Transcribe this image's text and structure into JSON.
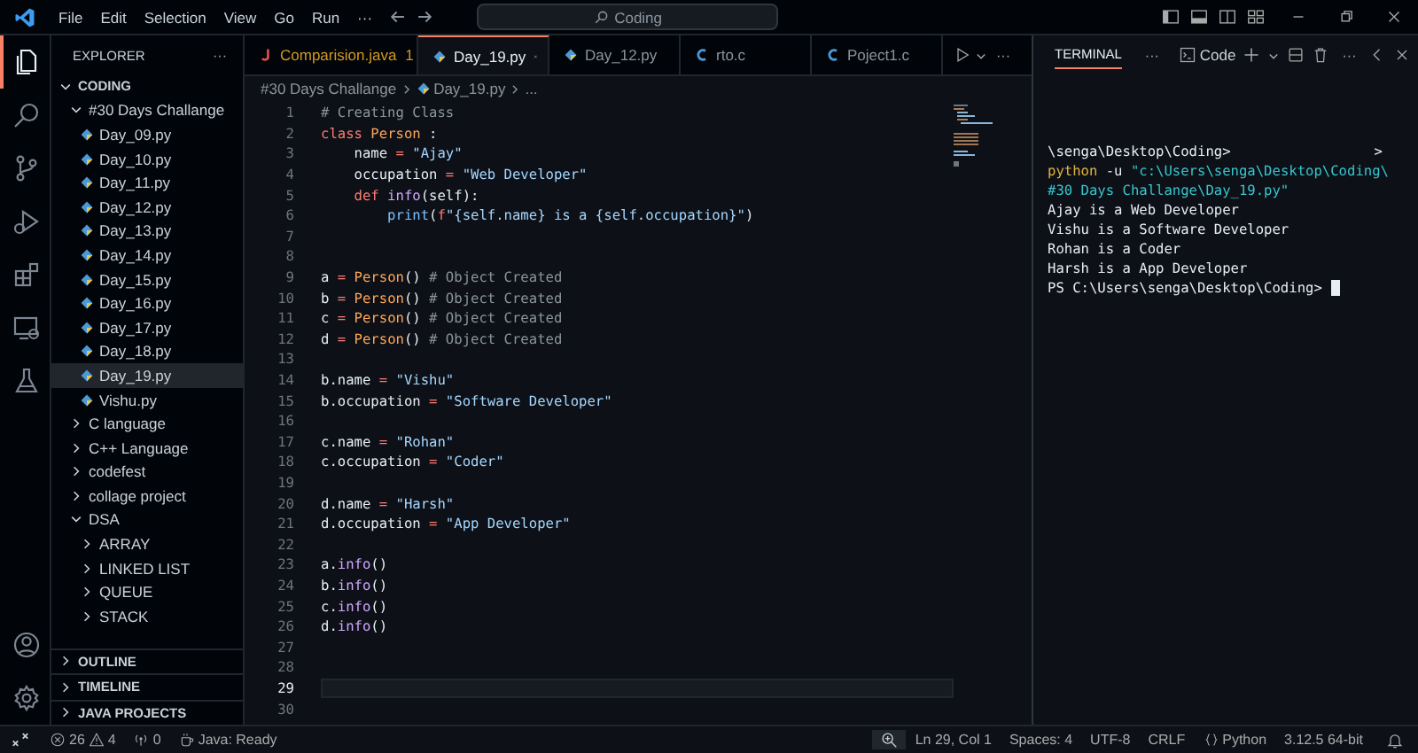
{
  "title_bar": {
    "menu": [
      "File",
      "Edit",
      "Selection",
      "View",
      "Go",
      "Run",
      "···"
    ],
    "search": "Coding"
  },
  "activity_bar": {
    "items": [
      {
        "kind": "files",
        "selected": true
      },
      {
        "kind": "search",
        "selected": false
      },
      {
        "kind": "source-control",
        "selected": false
      },
      {
        "kind": "run",
        "selected": false
      },
      {
        "kind": "extensions",
        "selected": false
      },
      {
        "kind": "remote",
        "selected": false
      },
      {
        "kind": "testing",
        "selected": false
      }
    ],
    "bottom_items": [
      {
        "kind": "account"
      },
      {
        "kind": "settings"
      }
    ]
  },
  "sidebar": {
    "title": "EXPLORER",
    "more": "···",
    "tree": [
      {
        "label": "CODING",
        "kind": "root",
        "expanded": true,
        "selected": false,
        "children": [
          {
            "label": "#30 Days Challange",
            "kind": "folder",
            "expanded": true,
            "selected": false,
            "children": [
              {
                "label": "Day_09.py",
                "kind": "file",
                "selected": false
              },
              {
                "label": "Day_10.py",
                "kind": "file",
                "selected": false
              },
              {
                "label": "Day_11.py",
                "kind": "file",
                "selected": false
              },
              {
                "label": "Day_12.py",
                "kind": "file",
                "selected": false
              },
              {
                "label": "Day_13.py",
                "kind": "file",
                "selected": false
              },
              {
                "label": "Day_14.py",
                "kind": "file",
                "selected": false
              },
              {
                "label": "Day_15.py",
                "kind": "file",
                "selected": false
              },
              {
                "label": "Day_16.py",
                "kind": "file",
                "selected": false
              },
              {
                "label": "Day_17.py",
                "kind": "file",
                "selected": false
              },
              {
                "label": "Day_18.py",
                "kind": "file",
                "selected": false
              },
              {
                "label": "Day_19.py",
                "kind": "file",
                "selected": true
              },
              {
                "label": "Vishu.py",
                "kind": "file",
                "selected": false
              }
            ]
          },
          {
            "label": "C language",
            "kind": "folder",
            "expanded": false,
            "selected": false
          },
          {
            "label": "C++ Language",
            "kind": "folder",
            "expanded": false,
            "selected": false
          },
          {
            "label": "codefest",
            "kind": "folder",
            "expanded": false,
            "selected": false
          },
          {
            "label": "collage project",
            "kind": "folder",
            "expanded": false,
            "selected": false
          },
          {
            "label": "DSA",
            "kind": "folder",
            "expanded": true,
            "selected": false,
            "children": [
              {
                "label": "ARRAY",
                "kind": "folder",
                "expanded": false,
                "selected": false
              },
              {
                "label": "LINKED LIST",
                "kind": "folder",
                "expanded": false,
                "selected": false
              },
              {
                "label": "QUEUE",
                "kind": "folder",
                "expanded": false,
                "selected": false
              },
              {
                "label": "STACK",
                "kind": "folder",
                "expanded": false,
                "selected": false
              }
            ]
          }
        ]
      }
    ],
    "sections": [
      {
        "label": "OUTLINE",
        "expanded": false
      },
      {
        "label": "TIMELINE",
        "expanded": false
      },
      {
        "label": "JAVA PROJECTS",
        "expanded": false
      }
    ]
  },
  "editor": {
    "tabs": [
      {
        "label": "Comparision.java",
        "kind": "java",
        "problems": "1",
        "selected": false
      },
      {
        "label": "Day_19.py",
        "kind": "python",
        "selected": true
      },
      {
        "label": "Day_12.py",
        "kind": "python",
        "selected": false
      },
      {
        "label": "rto.c",
        "kind": "c",
        "selected": false
      },
      {
        "label": "Poject1.c",
        "kind": "c",
        "selected": false
      }
    ],
    "more": "···",
    "breadcrumb": [
      "#30 Days Challange",
      "Day_19.py",
      "..."
    ],
    "lines": [
      {
        "number": "1",
        "current": false,
        "tokens": [
          {
            "text": "# Creating Class",
            "kind": "comment"
          }
        ]
      },
      {
        "number": "2",
        "current": false,
        "tokens": [
          {
            "text": "class",
            "kind": "keyword"
          },
          {
            "text": " Person",
            "kind": "class"
          },
          {
            "text": " :"
          }
        ]
      },
      {
        "number": "3",
        "current": false,
        "tokens": [
          {
            "text": "    name "
          },
          {
            "text": "=",
            "kind": "op"
          },
          {
            "text": " \"Ajay\"",
            "kind": "string"
          }
        ]
      },
      {
        "number": "4",
        "current": false,
        "tokens": [
          {
            "text": "    occupation "
          },
          {
            "text": "=",
            "kind": "op"
          },
          {
            "text": " \"Web Developer\"",
            "kind": "string"
          }
        ]
      },
      {
        "number": "5",
        "current": false,
        "tokens": [
          {
            "text": "    def",
            "kind": "keyword"
          },
          {
            "text": " info",
            "kind": "func"
          },
          {
            "text": "(self):"
          }
        ]
      },
      {
        "number": "6",
        "current": false,
        "tokens": [
          {
            "text": "        print",
            "kind": "builtin"
          },
          {
            "text": "("
          },
          {
            "text": "f",
            "kind": "keyword"
          },
          {
            "text": "\"{self.name} is a {self.occupation}\"",
            "kind": "string"
          },
          {
            "text": ")"
          }
        ]
      },
      {
        "number": "7",
        "current": false
      },
      {
        "number": "8",
        "current": false
      },
      {
        "number": "9",
        "current": false,
        "tokens": [
          {
            "text": "a "
          },
          {
            "text": "=",
            "kind": "op"
          },
          {
            "text": " Person",
            "kind": "class"
          },
          {
            "text": "() "
          },
          {
            "text": "# Object Created",
            "kind": "comment"
          }
        ]
      },
      {
        "number": "10",
        "current": false,
        "tokens": [
          {
            "text": "b "
          },
          {
            "text": "=",
            "kind": "op"
          },
          {
            "text": " Person",
            "kind": "class"
          },
          {
            "text": "() "
          },
          {
            "text": "# Object Created",
            "kind": "comment"
          }
        ]
      },
      {
        "number": "11",
        "current": false,
        "tokens": [
          {
            "text": "c "
          },
          {
            "text": "=",
            "kind": "op"
          },
          {
            "text": " Person",
            "kind": "class"
          },
          {
            "text": "() "
          },
          {
            "text": "# Object Created",
            "kind": "comment"
          }
        ]
      },
      {
        "number": "12",
        "current": false,
        "tokens": [
          {
            "text": "d "
          },
          {
            "text": "=",
            "kind": "op"
          },
          {
            "text": " Person",
            "kind": "class"
          },
          {
            "text": "() "
          },
          {
            "text": "# Object Created",
            "kind": "comment"
          }
        ]
      },
      {
        "number": "13",
        "current": false
      },
      {
        "number": "14",
        "current": false,
        "tokens": [
          {
            "text": "b.name "
          },
          {
            "text": "=",
            "kind": "op"
          },
          {
            "text": " \"Vishu\"",
            "kind": "string"
          }
        ]
      },
      {
        "number": "15",
        "current": false,
        "tokens": [
          {
            "text": "b.occupation "
          },
          {
            "text": "=",
            "kind": "op"
          },
          {
            "text": " \"Software Developer\"",
            "kind": "string"
          }
        ]
      },
      {
        "number": "16",
        "current": false
      },
      {
        "number": "17",
        "current": false,
        "tokens": [
          {
            "text": "c.name "
          },
          {
            "text": "=",
            "kind": "op"
          },
          {
            "text": " \"Rohan\"",
            "kind": "string"
          }
        ]
      },
      {
        "number": "18",
        "current": false,
        "tokens": [
          {
            "text": "c.occupation "
          },
          {
            "text": "=",
            "kind": "op"
          },
          {
            "text": " \"Coder\"",
            "kind": "string"
          }
        ]
      },
      {
        "number": "19",
        "current": false
      },
      {
        "number": "20",
        "current": false,
        "tokens": [
          {
            "text": "d.name "
          },
          {
            "text": "=",
            "kind": "op"
          },
          {
            "text": " \"Harsh\"",
            "kind": "string"
          }
        ]
      },
      {
        "number": "21",
        "current": false,
        "tokens": [
          {
            "text": "d.occupation "
          },
          {
            "text": "=",
            "kind": "op"
          },
          {
            "text": " \"App Developer\"",
            "kind": "string"
          }
        ]
      },
      {
        "number": "22",
        "current": false
      },
      {
        "number": "23",
        "current": false,
        "tokens": [
          {
            "text": "a."
          },
          {
            "text": "info",
            "kind": "func"
          },
          {
            "text": "()"
          }
        ]
      },
      {
        "number": "24",
        "current": false,
        "tokens": [
          {
            "text": "b."
          },
          {
            "text": "info",
            "kind": "func"
          },
          {
            "text": "()"
          }
        ]
      },
      {
        "number": "25",
        "current": false,
        "tokens": [
          {
            "text": "c."
          },
          {
            "text": "info",
            "kind": "func"
          },
          {
            "text": "()"
          }
        ]
      },
      {
        "number": "26",
        "current": false,
        "tokens": [
          {
            "text": "d."
          },
          {
            "text": "info",
            "kind": "func"
          },
          {
            "text": "()"
          }
        ]
      },
      {
        "number": "27",
        "current": false
      },
      {
        "number": "28",
        "current": false
      },
      {
        "number": "29",
        "current": true
      },
      {
        "number": "30",
        "current": false
      }
    ]
  },
  "panel": {
    "tabs": [
      {
        "label": "TERMINAL",
        "selected": true
      }
    ],
    "more": "···",
    "shell": "Code",
    "more_actions": "···",
    "terminal": {
      "cursor": true,
      "lines": [
        {
          "tokens": [
            {
              "text": "\\senga\\Desktop\\Coding>"
            }
          ],
          "trailing": ">"
        },
        {
          "tokens": [
            {
              "text": "python",
              "kind": "cmd"
            },
            {
              "text": " -u "
            },
            {
              "text": "\"c:\\Users\\senga\\Desktop\\Coding\\",
              "kind": "string"
            }
          ]
        },
        {
          "tokens": [
            {
              "text": "#30 Days Challange\\Day_19.py\"",
              "kind": "string"
            }
          ]
        },
        {
          "tokens": [
            {
              "text": "Ajay is a Web Developer"
            }
          ]
        },
        {
          "tokens": [
            {
              "text": "Vishu is a Software Developer"
            }
          ]
        },
        {
          "tokens": [
            {
              "text": "Rohan is a Coder"
            }
          ]
        },
        {
          "tokens": [
            {
              "text": "Harsh is a App Developer"
            }
          ]
        },
        {
          "tokens": [
            {
              "text": "PS C:\\Users\\senga\\Desktop\\Coding>"
            }
          ]
        }
      ]
    }
  },
  "status_bar": {
    "errors": "26",
    "warnings": "4",
    "ports": "0",
    "java": "Java: Ready",
    "position": "Ln 29, Col 1",
    "spaces": "Spaces: 4",
    "encoding": "UTF-8",
    "eol": "CRLF",
    "language": "Python",
    "interpreter": "3.12.5 64-bit"
  }
}
